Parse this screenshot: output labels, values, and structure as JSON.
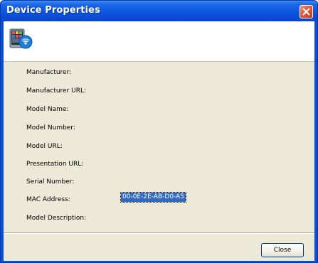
{
  "window": {
    "title": "Device Properties",
    "close_icon": "close-x-icon"
  },
  "header": {
    "icon": "media-device-icon"
  },
  "properties": [
    {
      "label": "Manufacturer:",
      "value": ""
    },
    {
      "label": "Manufacturer URL:",
      "value": ""
    },
    {
      "label": "Model Name:",
      "value": ""
    },
    {
      "label": "Model Number:",
      "value": ""
    },
    {
      "label": "Model URL:",
      "value": ""
    },
    {
      "label": "Presentation URL:",
      "value": ""
    },
    {
      "label": "Serial Number:",
      "value": ""
    },
    {
      "label": "MAC Address:",
      "value": "00-0E-2E-AB-D0-A5"
    },
    {
      "label": "Model Description:",
      "value": ""
    }
  ],
  "footer": {
    "close_label": "Close"
  },
  "colors": {
    "titlebar": "#0b4ad2",
    "client_bg": "#ece9d8",
    "selection": "#316ac5",
    "close_red": "#e2583c"
  }
}
